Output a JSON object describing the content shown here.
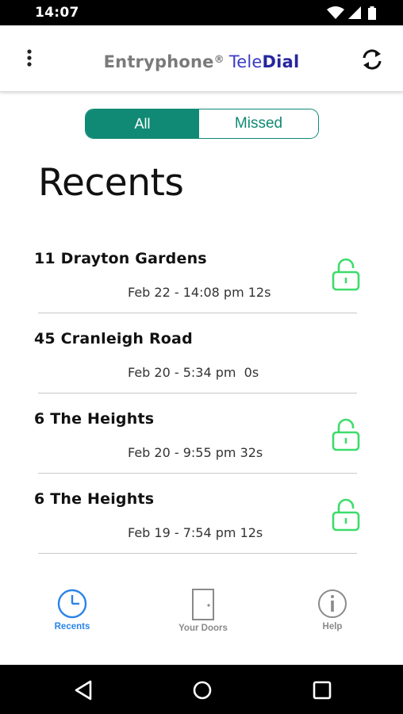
{
  "status_bar": {
    "time": "14:07",
    "icons": [
      "wifi-icon",
      "cellular-signal-icon",
      "battery-icon"
    ]
  },
  "header": {
    "menu_icon": "more-vert-icon",
    "brand": "Entryphone",
    "registered_mark": "®",
    "product_tele": "Tele",
    "product_dial": "Dial",
    "refresh_icon": "refresh-icon"
  },
  "filter": {
    "all_label": "All",
    "missed_label": "Missed",
    "selected": "All"
  },
  "page_title": "Recents",
  "calls": [
    {
      "address": "11 Drayton Gardens",
      "time": "Feb 22 - 14:08 pm 12s",
      "unlocked": true
    },
    {
      "address": "45 Cranleigh Road",
      "time": "Feb 20 - 5:34 pm  0s",
      "unlocked": false
    },
    {
      "address": "6 The Heights",
      "time": "Feb 20 - 9:55 pm 32s",
      "unlocked": true
    },
    {
      "address": "6 The Heights",
      "time": "Feb 19 - 7:54 pm 12s",
      "unlocked": true
    }
  ],
  "bottom_nav": {
    "recents_label": "Recents",
    "doors_label": "Your Doors",
    "help_label": "Help",
    "active": "Recents"
  },
  "colors": {
    "accent_teal": "#108a74",
    "unlock_green": "#3ddc6b",
    "nav_active_blue": "#2a84e8",
    "brand_blue": "#26269e"
  }
}
